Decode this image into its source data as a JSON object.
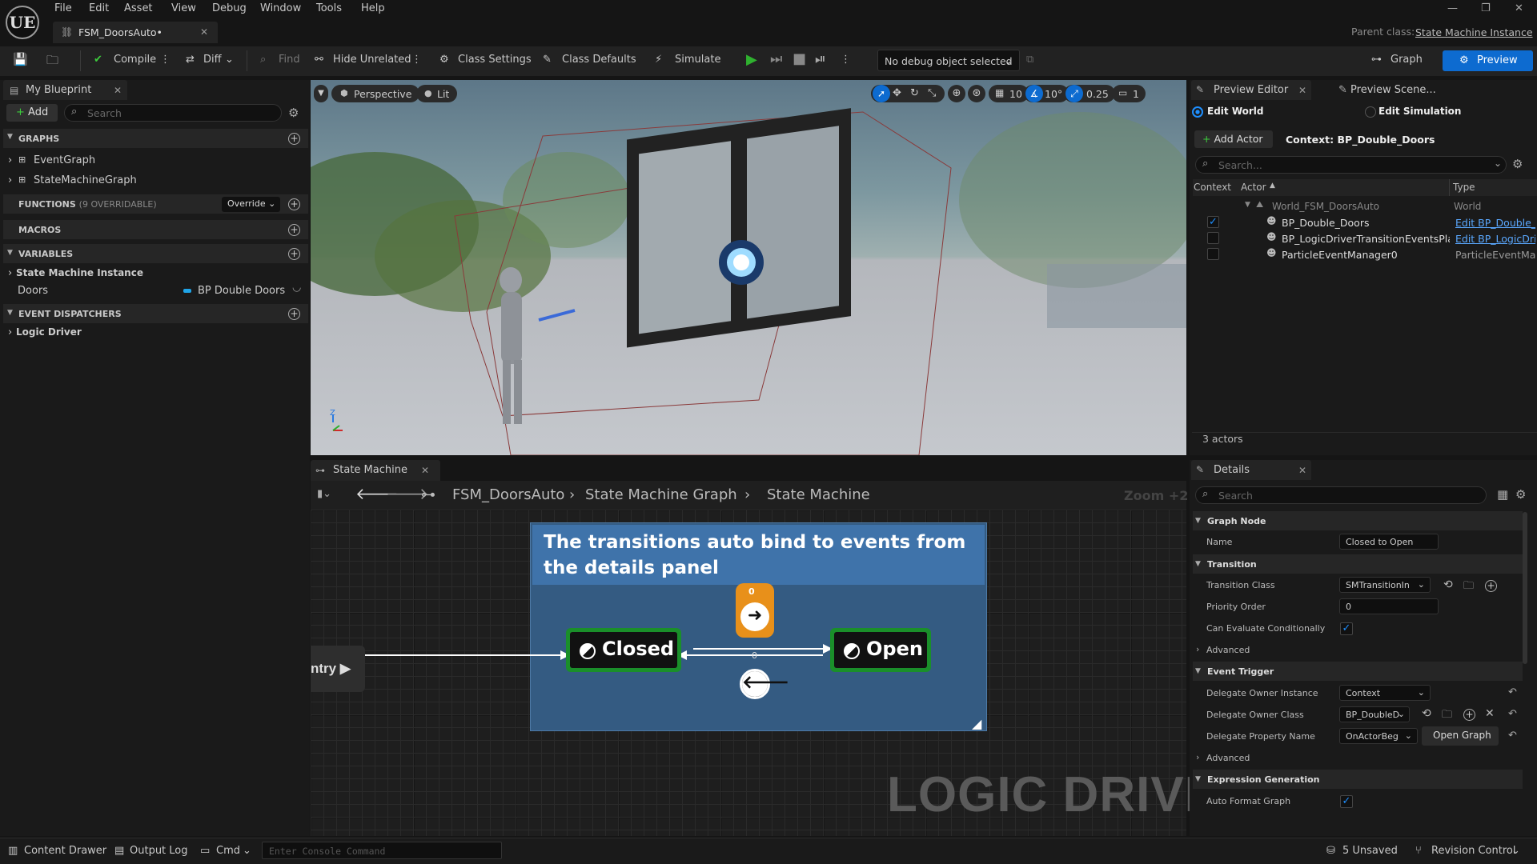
{
  "menu": {
    "items": [
      "File",
      "Edit",
      "Asset",
      "View",
      "Debug",
      "Window",
      "Tools",
      "Help"
    ],
    "logo": "UE"
  },
  "document": {
    "tab_title": "FSM_DoorsAuto•",
    "parent_label": "Parent class:",
    "parent_value": "State Machine Instance"
  },
  "toolbar": {
    "compile": "Compile",
    "diff": "Diff",
    "find": "Find",
    "hide_unrelated": "Hide Unrelated",
    "class_settings": "Class Settings",
    "class_defaults": "Class Defaults",
    "simulate": "Simulate",
    "debug_object": "No debug object selected",
    "graph": "Graph",
    "preview": "Preview"
  },
  "my_blueprint": {
    "tab": "My Blueprint",
    "add": "Add",
    "search_placeholder": "Search",
    "graphs_header": "GRAPHS",
    "graphs": [
      "EventGraph",
      "StateMachineGraph"
    ],
    "functions_header": "FUNCTIONS",
    "functions_count": "(9 OVERRIDABLE)",
    "override": "Override",
    "macros_header": "MACROS",
    "variables_header": "VARIABLES",
    "variables_category": "State Machine Instance",
    "variable_name": "Doors",
    "variable_type": "BP Double Doors",
    "event_dispatchers_header": "EVENT DISPATCHERS",
    "logic_driver": "Logic Driver"
  },
  "viewport": {
    "perspective": "Perspective",
    "lit": "Lit",
    "grid_value": "10",
    "angle_value": "10°",
    "scale_value": "0.25",
    "camera_value": "1",
    "axis_z": "Z"
  },
  "state_machine": {
    "tab": "State Machine",
    "breadcrumb": [
      "FSM_DoorsAuto",
      "State Machine Graph",
      "State Machine"
    ],
    "zoom": "Zoom +2",
    "comment": "The transitions auto bind to events from the details panel",
    "entry_label": "ntry",
    "state_closed": "Closed",
    "state_open": "Open",
    "priority_a": "0",
    "priority_b": "0",
    "watermark": "LOGIC DRIVER"
  },
  "preview_editor": {
    "tab": "Preview Editor",
    "tab2": "Preview Scene...",
    "edit_world": "Edit World",
    "edit_simulation": "Edit Simulation",
    "add_actor": "Add Actor",
    "context": "Context: BP_Double_Doors",
    "search_placeholder": "Search...",
    "columns": {
      "context": "Context",
      "actor": "Actor",
      "type": "Type"
    },
    "world_row": {
      "name": "World_FSM_DoorsAuto",
      "type": "World"
    },
    "actors": [
      {
        "name": "BP_Double_Doors",
        "type": "Edit BP_Double_I",
        "checked": true,
        "link": true
      },
      {
        "name": "BP_LogicDriverTransitionEventsPlay",
        "type": "Edit BP_LogicDri",
        "checked": false,
        "link": true
      },
      {
        "name": "ParticleEventManager0",
        "type": "ParticleEventMan",
        "checked": false,
        "link": false
      }
    ],
    "count": "3 actors"
  },
  "details": {
    "tab": "Details",
    "search_placeholder": "Search",
    "graph_node": "Graph Node",
    "name_label": "Name",
    "name_value": "Closed to Open",
    "transition": "Transition",
    "transition_class_label": "Transition Class",
    "transition_class_value": "SMTransitionIn",
    "priority_label": "Priority Order",
    "priority_value": "0",
    "can_evaluate_label": "Can Evaluate Conditionally",
    "advanced": "Advanced",
    "event_trigger": "Event Trigger",
    "delegate_owner_instance_label": "Delegate Owner Instance",
    "delegate_owner_instance_value": "Context",
    "delegate_owner_class_label": "Delegate Owner Class",
    "delegate_owner_class_value": "BP_DoubleD",
    "delegate_property_label": "Delegate Property Name",
    "delegate_property_value": "OnActorBeg",
    "open_graph": "Open Graph",
    "advanced2": "Advanced",
    "expression_generation": "Expression Generation",
    "auto_format_label": "Auto Format Graph"
  },
  "statusbar": {
    "content_drawer": "Content Drawer",
    "output_log": "Output Log",
    "cmd": "Cmd",
    "console_placeholder": "Enter Console Command",
    "unsaved": "5 Unsaved",
    "revision": "Revision Control"
  },
  "colors": {
    "accent": "#0d6bd0",
    "state_green": "#1a8f2a",
    "comment_blue": "#3f73aa",
    "transition_orange": "#e8901a",
    "play_green": "#2fb12f"
  }
}
